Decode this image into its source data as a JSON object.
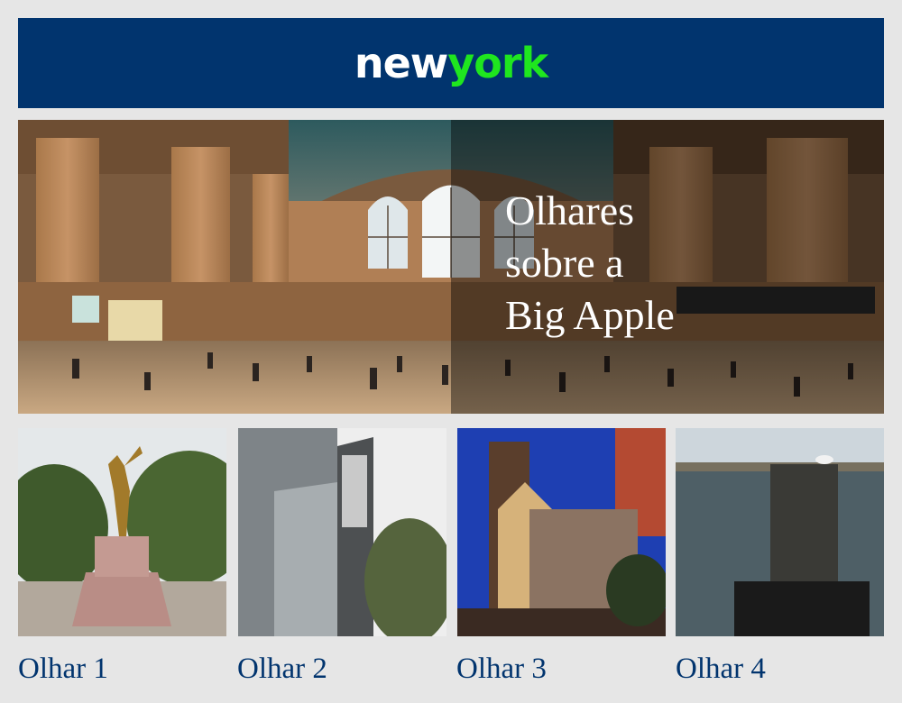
{
  "header": {
    "logo_part1": "new",
    "logo_part2": "york",
    "bg_color": "#01346e",
    "accent_color": "#1fe61f"
  },
  "hero": {
    "title_lines": [
      "Olhares",
      "sobre a",
      "Big Apple"
    ]
  },
  "gallery": [
    {
      "caption": "Olhar 1"
    },
    {
      "caption": "Olhar 2"
    },
    {
      "caption": "Olhar 3"
    },
    {
      "caption": "Olhar 4"
    }
  ]
}
